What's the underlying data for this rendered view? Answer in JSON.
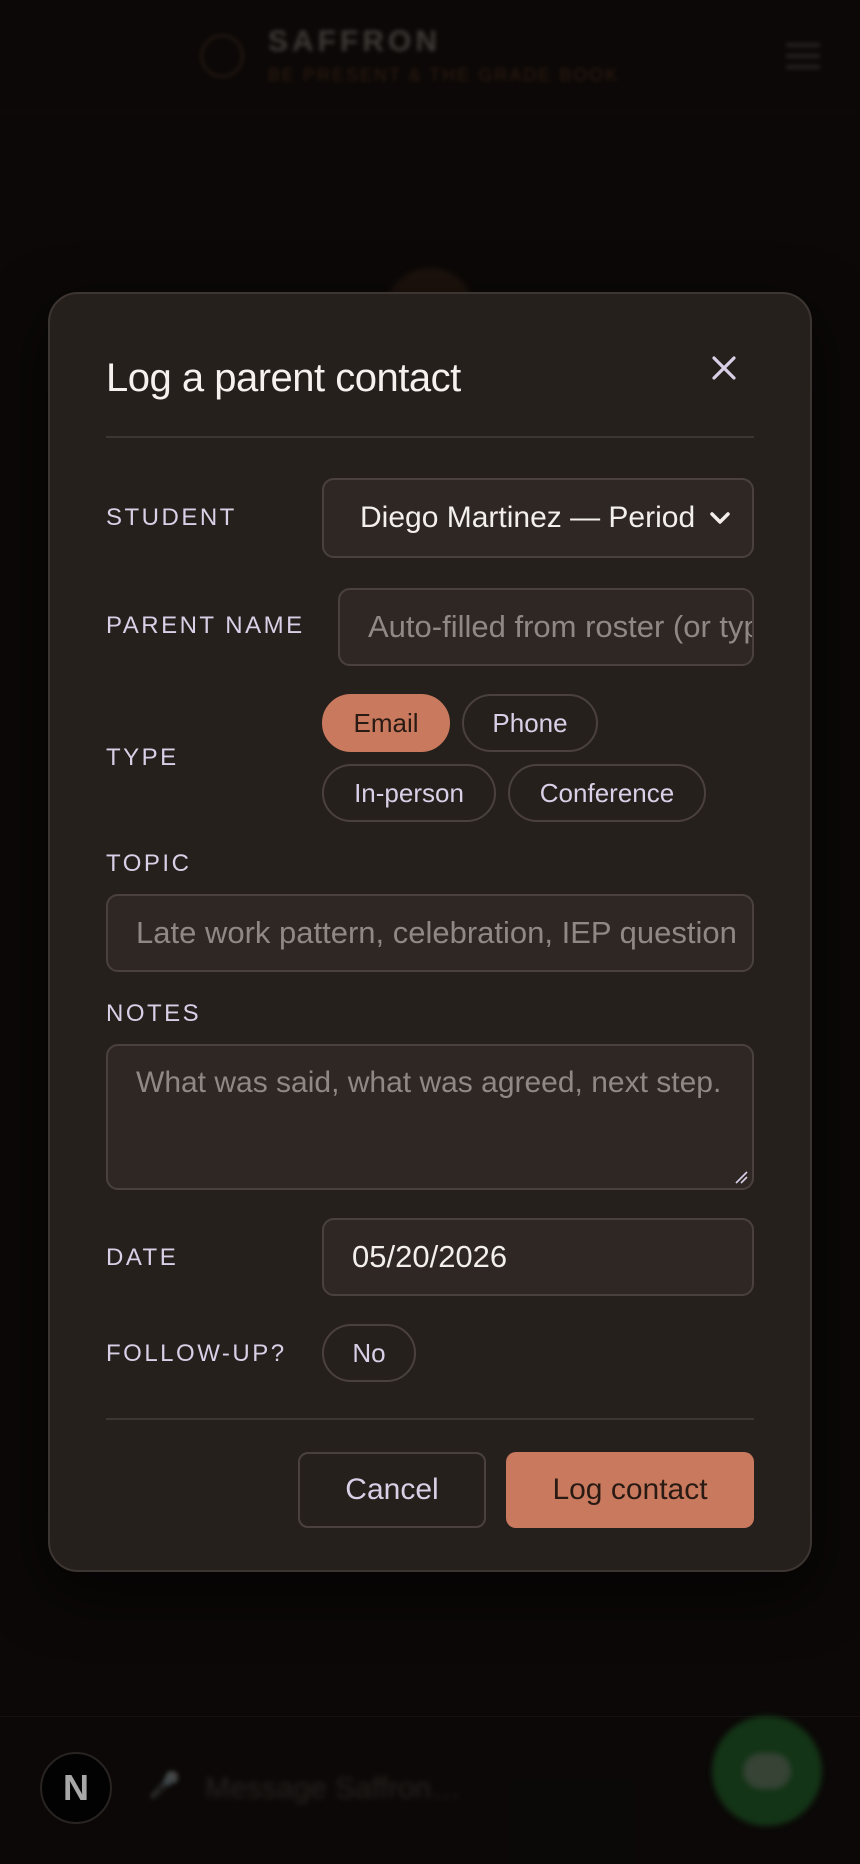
{
  "app": {
    "name": "SAFFRON",
    "tagline": "BE PRESENT & THE GRADE BOOK",
    "composer_placeholder": "Message Saffron…",
    "n_badge": "N"
  },
  "modal": {
    "title": "Log a parent contact",
    "student": {
      "label": "STUDENT",
      "value": "Diego Martinez — Period"
    },
    "parent_name": {
      "label": "PARENT NAME",
      "placeholder": "Auto-filled from roster (or type)"
    },
    "type": {
      "label": "TYPE",
      "options": [
        "Email",
        "Phone",
        "In-person",
        "Conference"
      ],
      "selected": "Email"
    },
    "topic": {
      "label": "TOPIC",
      "placeholder": "Late work pattern, celebration, IEP question"
    },
    "notes": {
      "label": "NOTES",
      "placeholder": "What was said, what was agreed, next step."
    },
    "date": {
      "label": "DATE",
      "value": "05/20/2026"
    },
    "follow_up": {
      "label": "FOLLOW-UP?",
      "value": "No"
    },
    "buttons": {
      "cancel": "Cancel",
      "submit": "Log contact"
    }
  },
  "colors": {
    "accent": "#c97a5e",
    "modal_bg": "#26201d",
    "page_bg": "#0d0a08"
  }
}
